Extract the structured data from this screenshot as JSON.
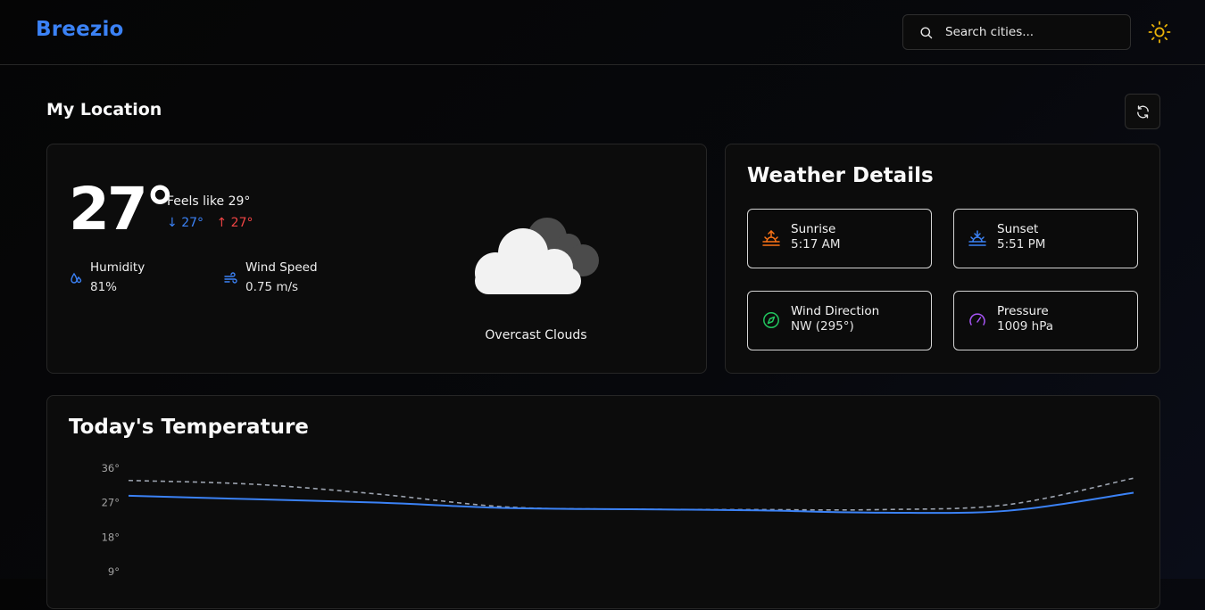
{
  "header": {
    "brand": "Breezio",
    "search_placeholder": "Search cities..."
  },
  "location": {
    "section_title": "My Location"
  },
  "current": {
    "temperature": "27°",
    "feels_like": "Feels like 29°",
    "min_temp": "27°",
    "max_temp": "27°",
    "humidity_label": "Humidity",
    "humidity_value": "81%",
    "wind_label": "Wind Speed",
    "wind_value": "0.75 m/s",
    "condition": "Overcast Clouds",
    "icon": "overcast-clouds-icon"
  },
  "details": {
    "title": "Weather Details",
    "tiles": [
      {
        "label": "Sunrise",
        "value": "5:17 AM",
        "icon": "sunrise-icon",
        "color": "#f97316"
      },
      {
        "label": "Sunset",
        "value": "5:51 PM",
        "icon": "sunset-icon",
        "color": "#3b82f6"
      },
      {
        "label": "Wind Direction",
        "value": "NW (295°)",
        "icon": "compass-icon",
        "color": "#22c55e"
      },
      {
        "label": "Pressure",
        "value": "1009 hPa",
        "icon": "gauge-icon",
        "color": "#a855f7"
      }
    ]
  },
  "colors": {
    "accent": "#3b82f6",
    "min_temp": "#3b82f6",
    "max_temp": "#ef4444",
    "sun_icon": "#eab308"
  },
  "chart_data": {
    "type": "line",
    "title": "Today's Temperature",
    "y_ticks": [
      "36°",
      "27°",
      "18°",
      "9°"
    ],
    "ylim": [
      9,
      36
    ],
    "grid": false,
    "series": [
      {
        "values": [
          28.8,
          27.9,
          27.0,
          25.6,
          25.3,
          25.0,
          24.4,
          24.9,
          29.6
        ],
        "color": "#3b82f6",
        "style": "solid"
      },
      {
        "values": [
          32.8,
          31.8,
          29.2,
          25.9,
          25.3,
          25.2,
          25.2,
          26.5,
          33.4
        ],
        "color": "#9ca3af",
        "style": "dashed"
      }
    ]
  }
}
